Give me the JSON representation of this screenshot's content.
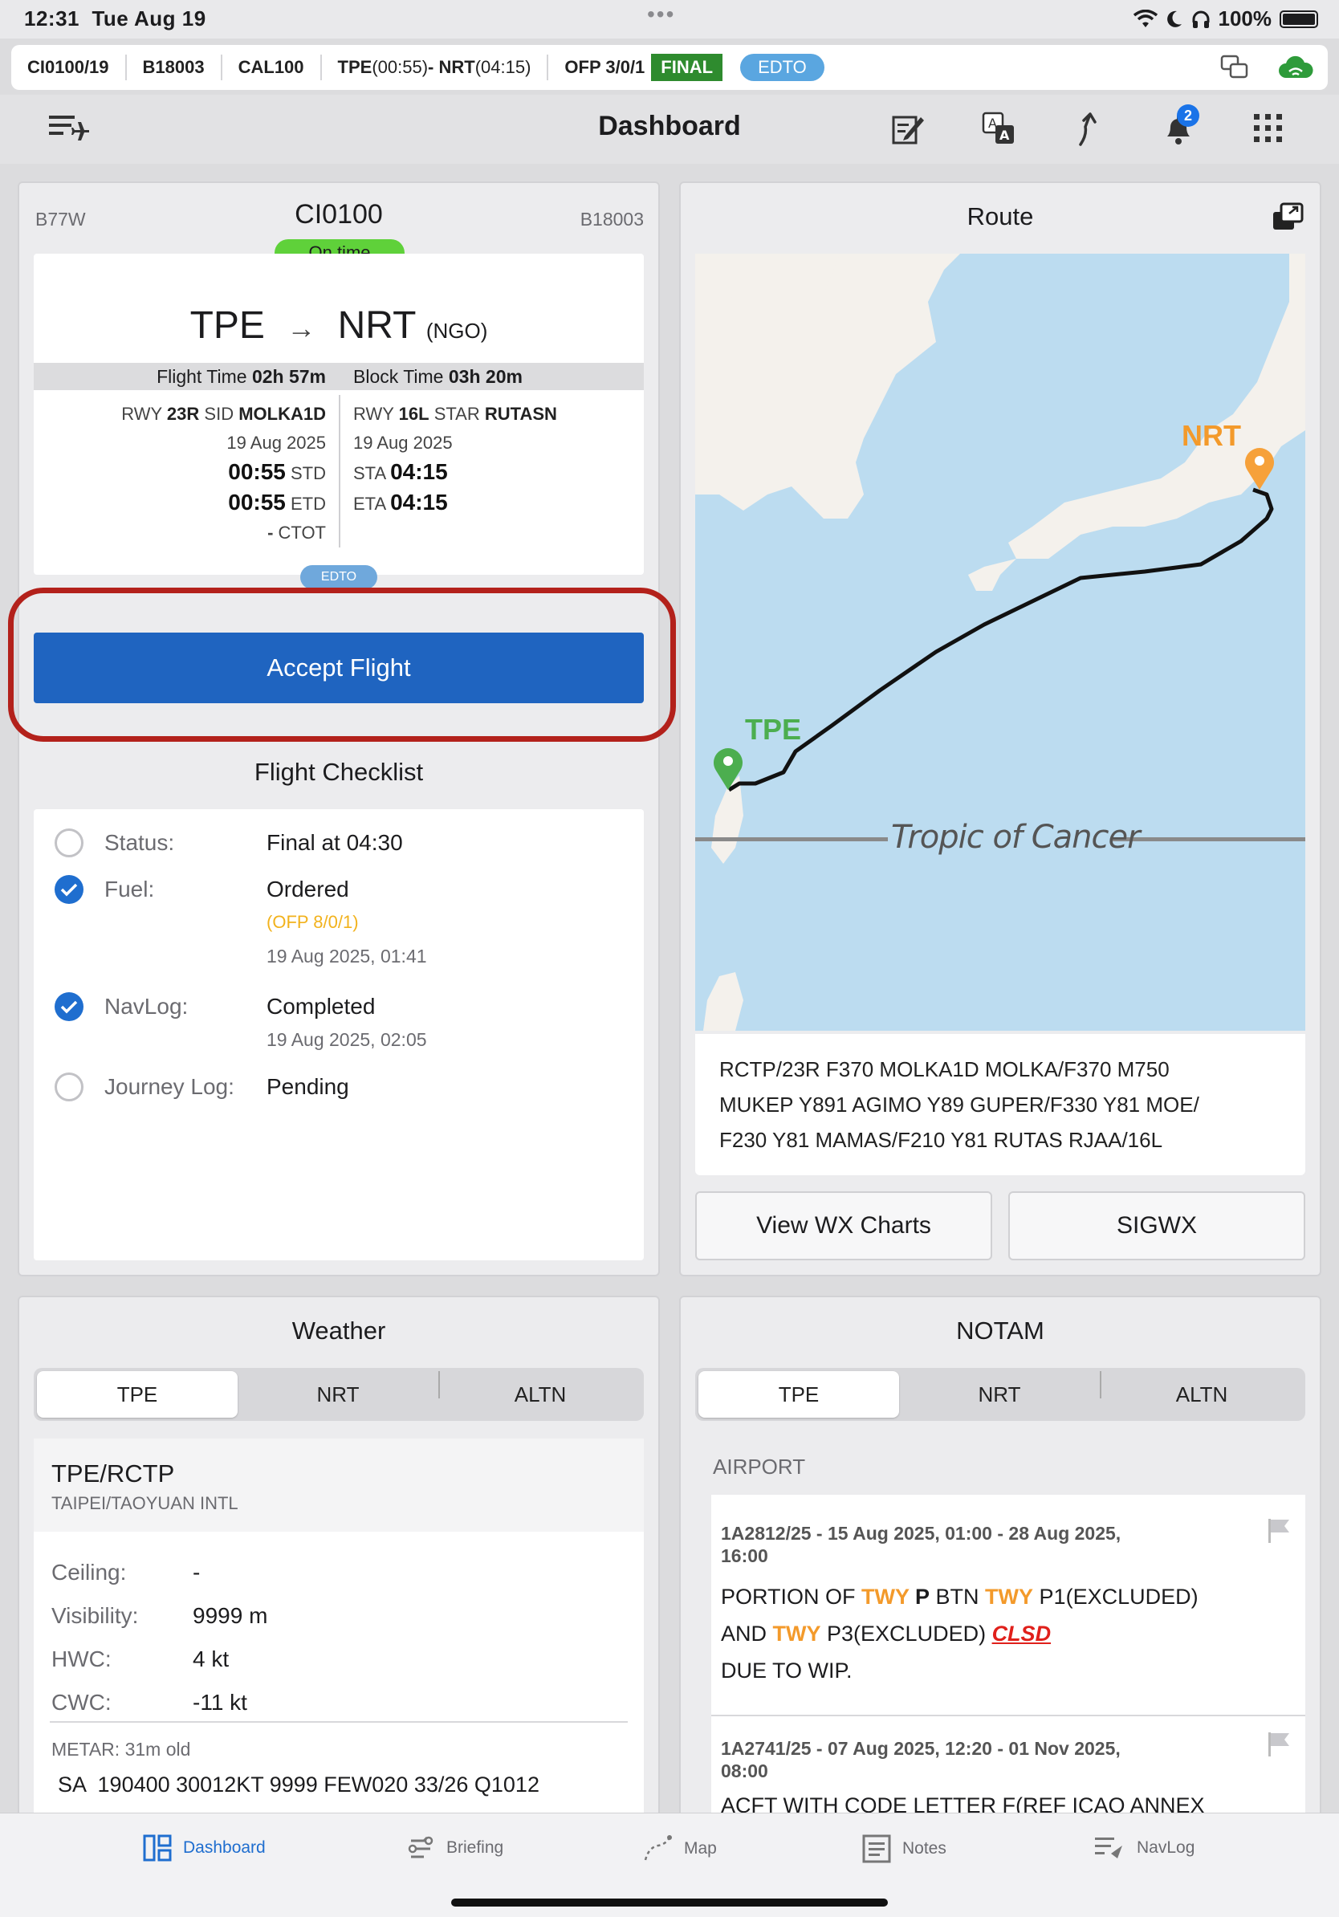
{
  "status_bar": {
    "time": "12:31",
    "date": "Tue Aug 19",
    "battery": "100%"
  },
  "flight_bar": {
    "flight_id": "CI0100/19",
    "tail": "B18003",
    "callsign": "CAL100",
    "route_times_a": "TPE ",
    "route_times_b": "(00:55)",
    "route_times_c": " - NRT ",
    "route_times_d": "(04:15)",
    "ofp": "OFP 3/0/1",
    "final_badge": "FINAL",
    "edto_badge": "EDTO"
  },
  "toolbar": {
    "title": "Dashboard",
    "notification_count": "2"
  },
  "flight_card": {
    "aircraft_type": "B77W",
    "flight_number": "CI0100",
    "registration": "B18003",
    "status_badge": "On time",
    "origin": "TPE",
    "arrow": "→",
    "destination": "NRT",
    "alternate": "(NGO)",
    "flight_time_label": "Flight Time",
    "flight_time": "02h 57m",
    "block_time_label": "Block Time",
    "block_time": "03h 20m",
    "dep": {
      "rwy_label": "RWY",
      "rwy": "23R",
      "sid_label": "SID",
      "sid": "MOLKA1D",
      "date": "19 Aug 2025",
      "std": "00:55",
      "std_label": "STD",
      "etd": "00:55",
      "etd_label": "ETD",
      "ctot": "-",
      "ctot_label": "CTOT"
    },
    "arr": {
      "rwy_label": "RWY",
      "rwy": "16L",
      "star_label": "STAR",
      "star": "RUTASN",
      "date": "19 Aug 2025",
      "sta_label": "STA",
      "sta": "04:15",
      "eta_label": "ETA",
      "eta": "04:15"
    },
    "edto_tag": "EDTO",
    "accept_button": "Accept Flight"
  },
  "checklist": {
    "title": "Flight Checklist",
    "items": [
      {
        "label": "Status:",
        "value": "Final at 04:30",
        "checked": false
      },
      {
        "label": "Fuel:",
        "value": "Ordered",
        "note": "(OFP 8/0/1)",
        "time": "19 Aug 2025, 01:41",
        "checked": true
      },
      {
        "label": "NavLog:",
        "value": "Completed",
        "time": "19 Aug 2025, 02:05",
        "checked": true
      },
      {
        "label": "Journey Log:",
        "value": "Pending",
        "checked": false
      }
    ]
  },
  "route": {
    "title": "Route",
    "origin_label": "TPE",
    "dest_label": "NRT",
    "map_label": "Tropic of Cancer",
    "route_line1": "RCTP/23R F370 MOLKA1D MOLKA/F370 M750",
    "route_line2": "MUKEP Y891 AGIMO Y89 GUPER/F330 Y81 MOE/",
    "route_line3": "F230 Y81 MAMAS/F210 Y81 RUTAS RJAA/16L",
    "wx_button": "View WX Charts",
    "sigwx_button": "SIGWX"
  },
  "weather": {
    "title": "Weather",
    "tabs": [
      "TPE",
      "NRT",
      "ALTN"
    ],
    "station": "TPE/RCTP",
    "station_name": "TAIPEI/TAOYUAN INTL",
    "rows": [
      {
        "label": "Ceiling:",
        "value": "-"
      },
      {
        "label": "Visibility:",
        "value": "9999 m"
      },
      {
        "label": "HWC:",
        "value": "4 kt"
      },
      {
        "label": "CWC:",
        "value": "-11 kt"
      }
    ],
    "metar_label": "METAR: 31m old",
    "metar": "SA  190400 30012KT 9999 FEW020 33/26 Q1012"
  },
  "notam": {
    "title": "NOTAM",
    "tabs": [
      "TPE",
      "NRT",
      "ALTN"
    ],
    "section": "AIRPORT",
    "n1_head1": "1A2812/25 - 15 Aug 2025, 01:00 - 28 Aug 2025,",
    "n1_head2": "16:00",
    "n1_a": "PORTION OF ",
    "n1_twy1": "TWY",
    "n1_b": " P",
    "n1_c": " BTN ",
    "n1_twy2": "TWY",
    "n1_d": " P1(EXCLUDED)",
    "n1_e": "AND ",
    "n1_twy3": "TWY",
    "n1_f": " P3(EXCLUDED) ",
    "n1_clsd": "CLSD",
    "n1_g": "DUE TO WIP.",
    "n2_head1": "1A2741/25 - 07 Aug 2025, 12:20 - 01 Nov 2025,",
    "n2_head2": "08:00",
    "n2_text": "ACFT WITH CODE LETTER F(REF ICAO ANNEX"
  },
  "bottom_tabs": [
    {
      "label": "Dashboard",
      "icon": "dashboard-icon"
    },
    {
      "label": "Briefing",
      "icon": "briefing-icon"
    },
    {
      "label": "Map",
      "icon": "map-icon"
    },
    {
      "label": "Notes",
      "icon": "notes-icon"
    },
    {
      "label": "NavLog",
      "icon": "navlog-icon"
    }
  ],
  "colors": {
    "accent": "#1f6ecf",
    "final": "#2e8b2e",
    "on_time": "#5fd13a",
    "orange": "#f39a2b",
    "highlight_box": "#b3211b"
  }
}
